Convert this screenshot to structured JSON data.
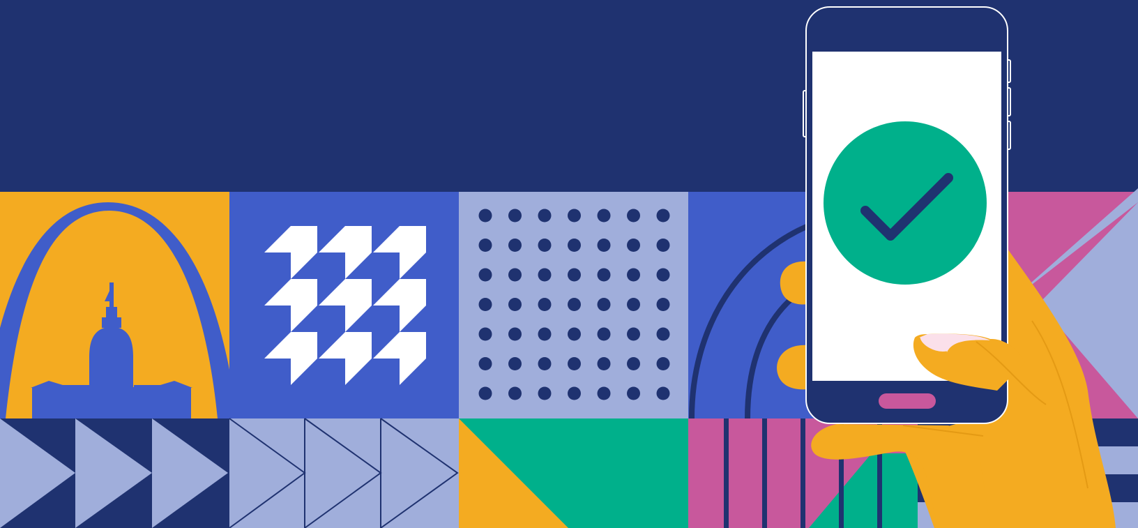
{
  "illustration": {
    "subject": "hand-holding-phone-with-checkmark-over-geometric-pattern",
    "icons": [
      "gateway-arch-icon",
      "capitol-dome-icon",
      "checkmark-icon",
      "smartphone-icon",
      "hand-icon"
    ],
    "colors": {
      "navy": "#1f3270",
      "royal_blue": "#405dc9",
      "periwinkle": "#a0aedb",
      "gold": "#f4ab21",
      "green": "#00b08b",
      "pink": "#c8589c",
      "white": "#ffffff"
    }
  }
}
